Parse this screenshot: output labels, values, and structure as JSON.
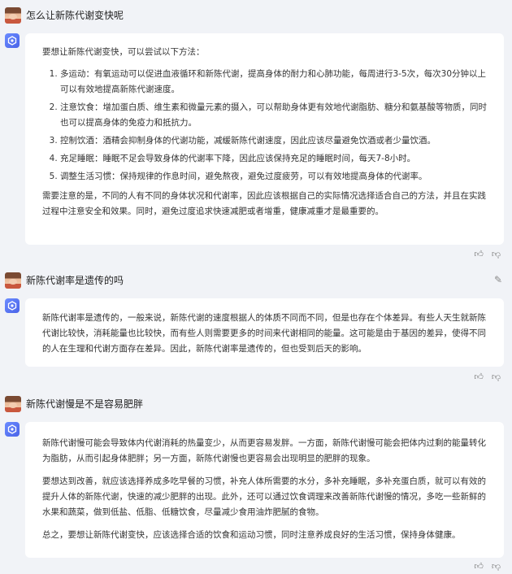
{
  "conversation": [
    {
      "question": "怎么让新陈代谢变快呢",
      "answer_intro": "要想让新陈代谢变快，可以尝试以下方法：",
      "answer_list": [
        "多运动：有氧运动可以促进血液循环和新陈代谢，提高身体的耐力和心肺功能，每周进行3-5次，每次30分钟以上可以有效地提高新陈代谢速度。",
        "注意饮食：增加蛋白质、维生素和微量元素的摄入，可以帮助身体更有效地代谢脂肪、糖分和氨基酸等物质，同时也可以提高身体的免疫力和抵抗力。",
        "控制饮酒：酒精会抑制身体的代谢功能，减缓新陈代谢速度，因此应该尽量避免饮酒或者少量饮酒。",
        "充足睡眠：睡眠不足会导致身体的代谢率下降，因此应该保持充足的睡眠时间，每天7-8小时。",
        "调整生活习惯：保持规律的作息时间，避免熬夜，避免过度疲劳，可以有效地提高身体的代谢率。"
      ],
      "answer_outro": "需要注意的是，不同的人有不同的身体状况和代谢率，因此应该根据自己的实际情况选择适合自己的方法，并且在实践过程中注意安全和效果。同时，避免过度追求快速减肥或者增重，健康减重才是最重要的。"
    },
    {
      "question": "新陈代谢率是遗传的吗",
      "answer": "新陈代谢率是遗传的，一般来说，新陈代谢的速度根据人的体质不同而不同，但是也存在个体差异。有些人天生就新陈代谢比较快，消耗能量也比较快，而有些人则需要更多的时间来代谢相同的能量。这可能是由于基因的差异，使得不同的人在生理和代谢方面存在差异。因此，新陈代谢率是遗传的，但也受到后天的影响。"
    },
    {
      "question": "新陈代谢慢是不是容易肥胖",
      "answer_paragraphs": [
        "新陈代谢慢可能会导致体内代谢消耗的热量变少，从而更容易发胖。一方面，新陈代谢慢可能会把体内过剩的能量转化为脂肪，从而引起身体肥胖；另一方面，新陈代谢慢也更容易会出现明显的肥胖的现象。",
        "要想达到改善，就应该选择养成多吃早餐的习惯，补充人体所需要的水分，多补充睡眠，多补充蛋白质，就可以有效的提升人体的新陈代谢，快速的减少肥胖的出现。此外，还可以通过饮食调理来改善新陈代谢慢的情况，多吃一些新鲜的水果和蔬菜，做到低盐、低脂、低糖饮食，尽量减少食用油炸肥腻的食物。",
        "总之，要想让新陈代谢变快，应该选择合适的饮食和运动习惯，同时注意养成良好的生活习惯，保持身体健康。"
      ]
    }
  ],
  "icons": {
    "like": "thumbs-up",
    "dislike": "thumbs-down",
    "edit": "pencil"
  },
  "colors": {
    "background": "#f1f3f7",
    "card": "#ffffff",
    "bot_icon": "#5b76f2"
  }
}
